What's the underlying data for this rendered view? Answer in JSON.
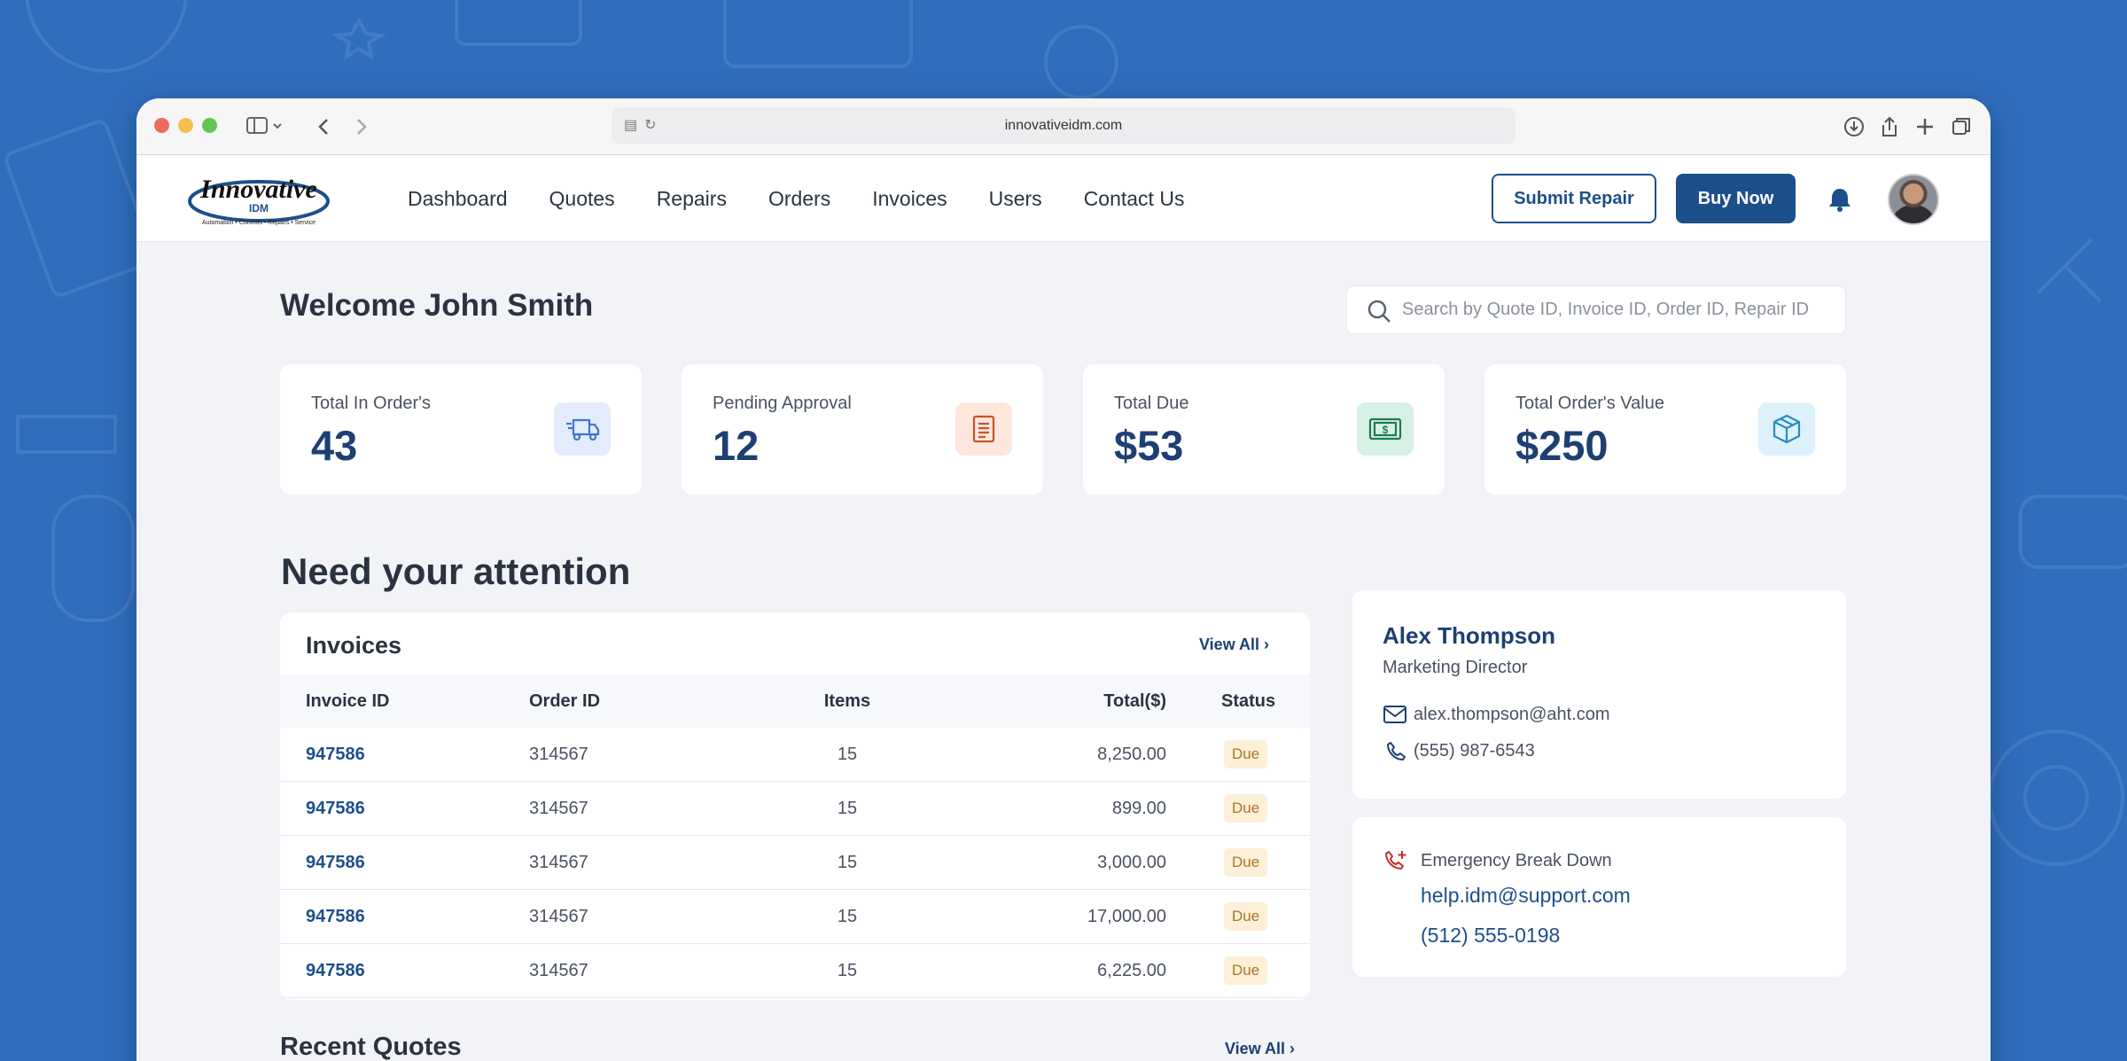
{
  "browser": {
    "url": "innovativeidm.com"
  },
  "nav": {
    "logo_text": "Innovative",
    "logo_sub": "IDM",
    "logo_tagline": "Automation • Controls • Repairs • Service",
    "items": [
      "Dashboard",
      "Quotes",
      "Repairs",
      "Orders",
      "Invoices",
      "Users",
      "Contact Us"
    ],
    "submit_repair": "Submit Repair",
    "buy_now": "Buy Now"
  },
  "welcome": "Welcome John Smith",
  "search": {
    "placeholder": "Search by Quote ID, Invoice ID, Order ID, Repair ID"
  },
  "stats": [
    {
      "label": "Total In Order's",
      "value": "43",
      "icon": "truck-icon",
      "color": "#e3ecfa"
    },
    {
      "label": "Pending Approval",
      "value": "12",
      "icon": "document-icon",
      "color": "#fde6dc"
    },
    {
      "label": "Total Due",
      "value": "$53",
      "icon": "cash-icon",
      "color": "#d7f0e6"
    },
    {
      "label": "Total Order's Value",
      "value": "$250",
      "icon": "box-icon",
      "color": "#dcf1fa"
    }
  ],
  "attention_title": "Need your attention",
  "invoices": {
    "title": "Invoices",
    "view_all": "View All",
    "columns": [
      "Invoice ID",
      "Order ID",
      "Items",
      "Total($)",
      "Status"
    ],
    "rows": [
      {
        "invoice": "947586",
        "order": "314567",
        "items": "15",
        "total": "8,250.00",
        "status": "Due"
      },
      {
        "invoice": "947586",
        "order": "314567",
        "items": "15",
        "total": "899.00",
        "status": "Due"
      },
      {
        "invoice": "947586",
        "order": "314567",
        "items": "15",
        "total": "3,000.00",
        "status": "Due"
      },
      {
        "invoice": "947586",
        "order": "314567",
        "items": "15",
        "total": "17,000.00",
        "status": "Due"
      },
      {
        "invoice": "947586",
        "order": "314567",
        "items": "15",
        "total": "6,225.00",
        "status": "Due"
      }
    ]
  },
  "contact": {
    "name": "Alex Thompson",
    "role": "Marketing Director",
    "email": "alex.thompson@aht.com",
    "phone": "(555) 987-6543"
  },
  "emergency": {
    "label": "Emergency Break Down",
    "email": "help.idm@support.com",
    "phone": "(512) 555-0198"
  },
  "recent_quotes": {
    "title": "Recent Quotes",
    "view_all": "View All"
  }
}
